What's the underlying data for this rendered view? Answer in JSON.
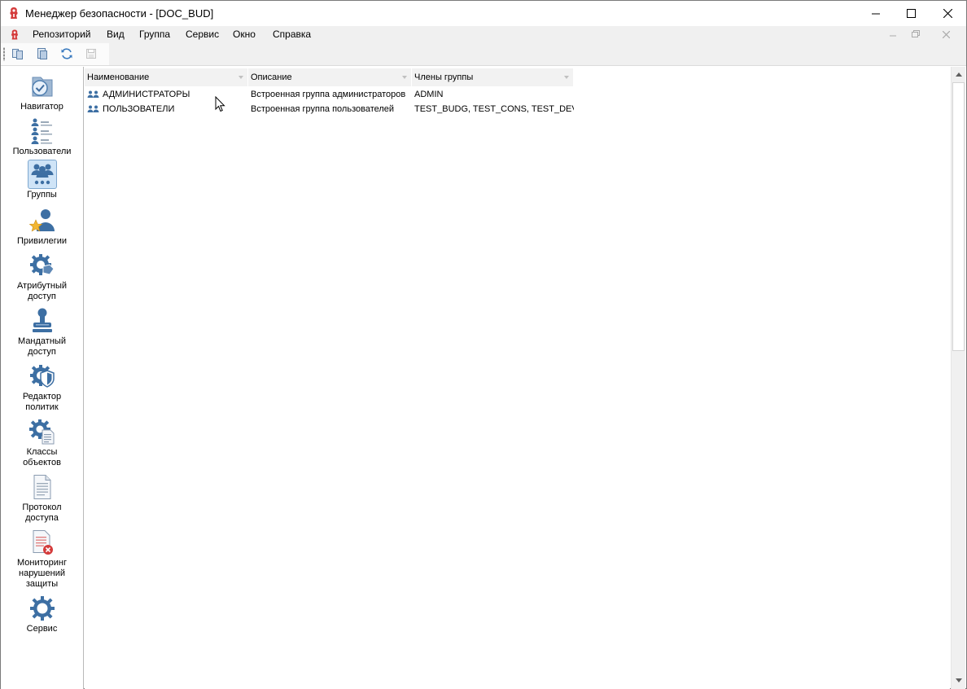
{
  "window": {
    "title": "Менеджер безопасности - [DOC_BUD]"
  },
  "menu": {
    "items": [
      "Репозиторий",
      "Вид",
      "Группа",
      "Сервис",
      "Окно",
      "Справка"
    ]
  },
  "toolbar": {
    "buttons": [
      "copy-icon",
      "paste-icon",
      "refresh-icon",
      "save-icon"
    ]
  },
  "nav": {
    "items": [
      {
        "label": "Навигатор",
        "icon": "folder-check-icon",
        "active": false
      },
      {
        "label": "Пользователи",
        "icon": "users-list-icon",
        "active": false
      },
      {
        "label": "Группы",
        "icon": "groups-icon",
        "active": true
      },
      {
        "label": "Привилегии",
        "icon": "user-star-icon",
        "active": false
      },
      {
        "label": "Атрибутный\nдоступ",
        "icon": "gear-tag-icon",
        "active": false
      },
      {
        "label": "Мандатный\nдоступ",
        "icon": "stamp-icon",
        "active": false
      },
      {
        "label": "Редактор\nполитик",
        "icon": "gear-shield-icon",
        "active": false
      },
      {
        "label": "Классы\nобъектов",
        "icon": "gear-document-icon",
        "active": false
      },
      {
        "label": "Протокол\nдоступа",
        "icon": "document-icon",
        "active": false
      },
      {
        "label": "Мониторинг\nнарушений\nзащиты",
        "icon": "document-error-icon",
        "active": false
      },
      {
        "label": "Сервис",
        "icon": "gear-icon",
        "active": false
      }
    ]
  },
  "grid": {
    "columns": [
      "Наименование",
      "Описание",
      "Члены группы"
    ],
    "rows": [
      {
        "name": "АДМИНИСТРАТОРЫ",
        "description": "Встроенная группа администраторов",
        "members": "ADMIN"
      },
      {
        "name": "ПОЛЬЗОВАТЕЛИ",
        "description": "Встроенная группа пользователей",
        "members": "TEST_BUDG, TEST_CONS, TEST_DEV,..."
      }
    ]
  },
  "colors": {
    "accent_icon": "#3d6fa3",
    "active_nav_bg": "#cfe4f7",
    "header_bg": "#f2f2f2",
    "app_icon_red": "#d43b3b"
  }
}
